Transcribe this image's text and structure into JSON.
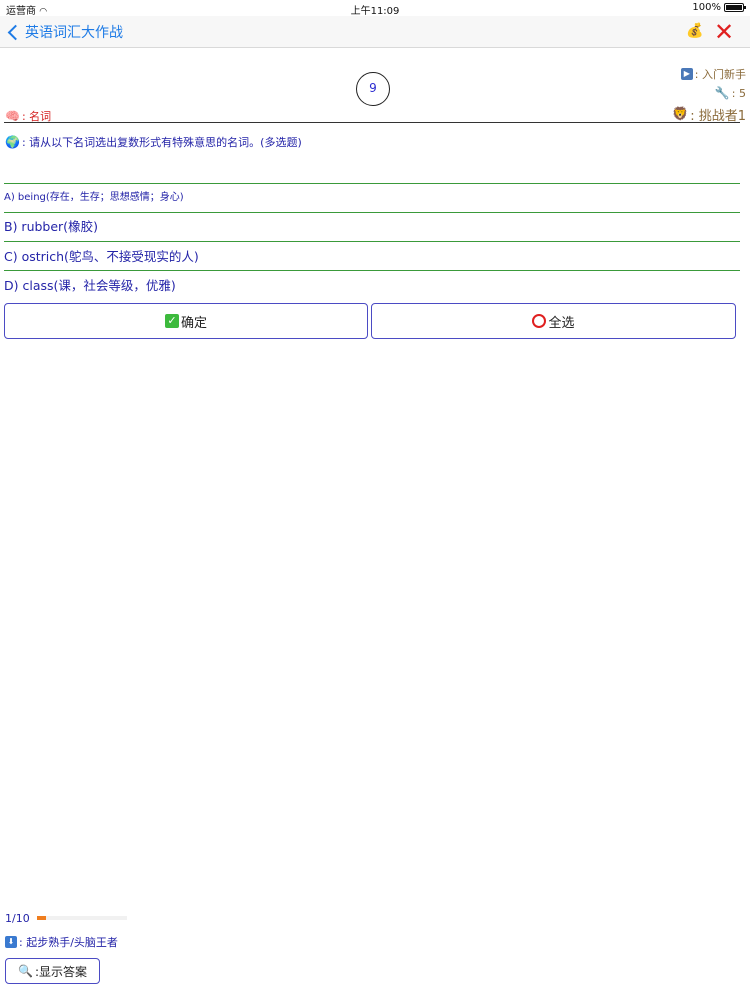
{
  "status_bar": {
    "carrier": "运营商",
    "time": "上午11:09",
    "battery": "100%"
  },
  "nav": {
    "back_label": "英语词汇大作战"
  },
  "header": {
    "counter": "9",
    "level": ": 入门新手",
    "tools": ": 5",
    "challenger": ": 挑战者1",
    "category": ": 名词"
  },
  "question": {
    "text": ": 请从以下名词选出复数形式有特殊意思的名词。(多选题)"
  },
  "options": [
    {
      "label": "A) being(存在，生存；思想感情；身心)"
    },
    {
      "label": "B) rubber(橡胶)"
    },
    {
      "label": "C) ostrich(鸵鸟、不接受现实的人)"
    },
    {
      "label": "D) class(课，社会等级，优雅)"
    }
  ],
  "buttons": {
    "confirm": "确定",
    "select_all": "全选",
    "show_answer": ":显示答案"
  },
  "progress": {
    "text": "1/10",
    "fraction": 0.1
  },
  "rank": {
    "text": ": 起步熟手/头脑王者"
  },
  "colors": {
    "accent": "#1e7be6",
    "close": "#e02020",
    "question_text": "#2424a8",
    "progress": "#ef7d1e",
    "divider": "#3a9a3a"
  },
  "icons": {
    "coin": "money-bag-icon",
    "close": "close-x-icon",
    "category": "brain-icon",
    "question": "globe-icon",
    "level": "play-icon",
    "tools": "wrench-icon",
    "challenger": "lion-icon",
    "confirm": "check-mark-icon",
    "select_all": "red-circle-icon",
    "rank": "down-arrow-icon",
    "show_answer": "magnifier-icon"
  }
}
